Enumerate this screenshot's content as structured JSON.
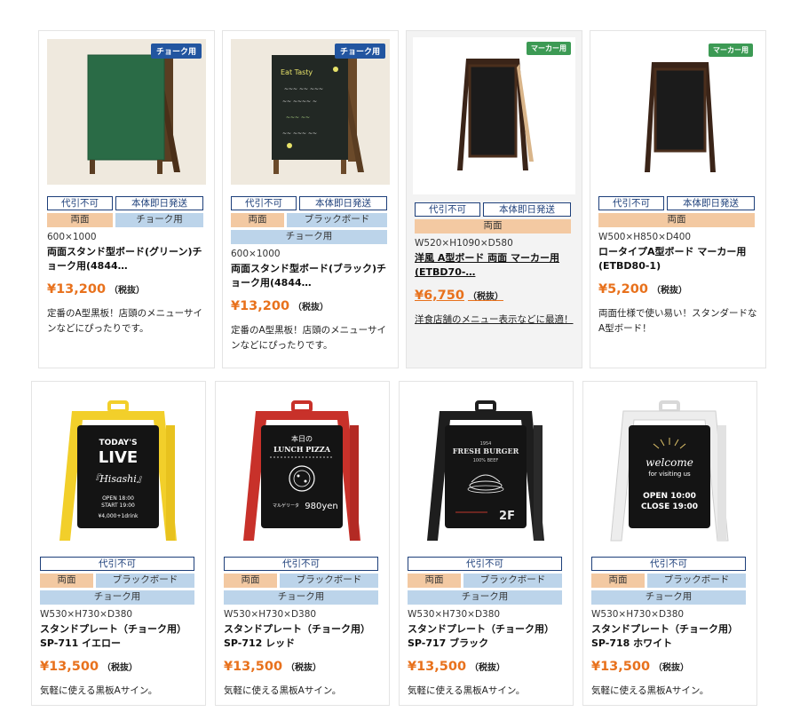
{
  "products": [
    {
      "badge": "チョーク用",
      "badge_type": "chalk",
      "image": "green-chalkboard-stand",
      "tags": [
        [
          "代引不可",
          "本体即日発送"
        ],
        [
          "両面",
          "チョーク用"
        ]
      ],
      "dims": "600×1000",
      "name": "両面スタンド型ボード(グリーン)チョーク用(4844…",
      "price": "¥13,200",
      "tax": "（税抜）",
      "desc": "定番のA型黒板！店頭のメニューサインなどにぴったりです。"
    },
    {
      "badge": "チョーク用",
      "badge_type": "chalk",
      "image": "black-chalkboard-stand",
      "tags": [
        [
          "代引不可",
          "本体即日発送"
        ],
        [
          "両面",
          "ブラックボード"
        ],
        [
          "チョーク用"
        ]
      ],
      "dims": "600×1000",
      "name": "両面スタンド型ボード(ブラック)チョーク用(4844…",
      "price": "¥13,200",
      "tax": "（税抜）",
      "desc": "定番のA型黒板！店頭のメニューサインなどにぴったりです。"
    },
    {
      "badge": "マーカー用",
      "badge_type": "marker",
      "image": "western-a-frame-board",
      "tags": [
        [
          "代引不可",
          "本体即日発送"
        ],
        [
          "両面"
        ]
      ],
      "dims": "W520×H1090×D580",
      "name": "洋風 A型ボード 両面 マーカー用(ETBD70-…",
      "price": "¥6,750",
      "tax": "（税抜）",
      "desc": "洋食店舗のメニュー表示などに最適！"
    },
    {
      "badge": "マーカー用",
      "badge_type": "marker",
      "image": "low-a-frame-board",
      "tags": [
        [
          "代引不可",
          "本体即日発送"
        ],
        [
          "両面"
        ]
      ],
      "dims": "W500×H850×D400",
      "name": "ロータイプA型ボード マーカー用(ETBD80-1)",
      "price": "¥5,200",
      "tax": "（税抜）",
      "desc": "両面仕様で使い易い！スタンダードなA型ボード！"
    },
    {
      "image": "yellow-stand-plate",
      "tags": [
        [
          "代引不可"
        ],
        [
          "両面",
          "ブラックボード"
        ],
        [
          "チョーク用"
        ]
      ],
      "dims": "W530×H730×D380",
      "name": "スタンドプレート（チョーク用）SP-711 イエロー",
      "price": "¥13,500",
      "tax": "（税抜）",
      "desc": "気軽に使える黒板Aサイン。",
      "sign": {
        "line1": "TODAY'S",
        "line2": "LIVE",
        "line3": "『Hisashi』",
        "line4": "OPEN 18:00",
        "line5": "START 19:00",
        "line6": "¥4,000+1drink"
      }
    },
    {
      "image": "red-stand-plate",
      "tags": [
        [
          "代引不可"
        ],
        [
          "両面",
          "ブラックボード"
        ],
        [
          "チョーク用"
        ]
      ],
      "dims": "W530×H730×D380",
      "name": "スタンドプレート（チョーク用）SP-712 レッド",
      "price": "¥13,500",
      "tax": "（税抜）",
      "desc": "気軽に使える黒板Aサイン。",
      "sign": {
        "line1": "本日の",
        "line2": "LUNCH PIZZA",
        "line3": "マルゲリータ",
        "line4": "980yen"
      }
    },
    {
      "image": "black-stand-plate",
      "tags": [
        [
          "代引不可"
        ],
        [
          "両面",
          "ブラックボード"
        ],
        [
          "チョーク用"
        ]
      ],
      "dims": "W530×H730×D380",
      "name": "スタンドプレート（チョーク用）SP-717 ブラック",
      "price": "¥13,500",
      "tax": "（税抜）",
      "desc": "気軽に使える黒板Aサイン。",
      "sign": {
        "line1": "1954",
        "line2": "FRESH BURGER",
        "line3": "100% BEEF",
        "line4": "2F"
      }
    },
    {
      "image": "white-stand-plate",
      "tags": [
        [
          "代引不可"
        ],
        [
          "両面",
          "ブラックボード"
        ],
        [
          "チョーク用"
        ]
      ],
      "dims": "W530×H730×D380",
      "name": "スタンドプレート（チョーク用）SP-718 ホワイト",
      "price": "¥13,500",
      "tax": "（税抜）",
      "desc": "気軽に使える黒板Aサイン。",
      "sign": {
        "line1": "welcome",
        "line2": "for visiting us",
        "line3": "OPEN  10:00",
        "line4": "CLOSE 19:00"
      }
    }
  ]
}
